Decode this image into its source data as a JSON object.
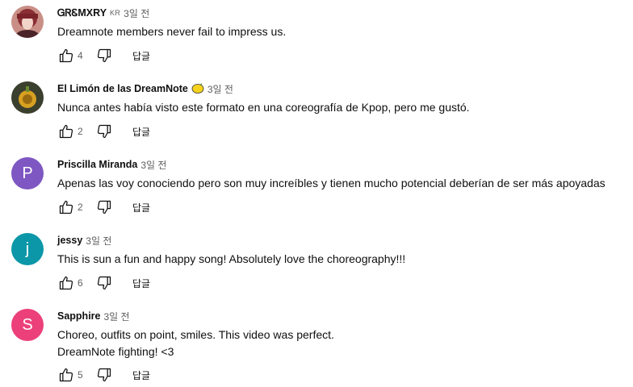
{
  "comments": [
    {
      "author": "ᏀᏒᏋMXRY",
      "flag": "KR",
      "time": "3일 전",
      "lines": [
        "Dreamnote members never fail to impress us."
      ],
      "likes": "4",
      "reply_label": "답글",
      "avatar": {
        "type": "photo",
        "icon": "profile-photo"
      }
    },
    {
      "author": "El Limón de las DreamNote",
      "badge_icon": "lemon-emoji",
      "time": "3일 전",
      "lines": [
        "Nunca antes había visto este formato en una coreografía de Kpop, pero me gustó."
      ],
      "likes": "2",
      "reply_label": "답글",
      "avatar": {
        "type": "photo",
        "icon": "profile-photo"
      }
    },
    {
      "author": "Priscilla Miranda",
      "time": "3일 전",
      "lines": [
        "Apenas las voy conociendo pero son muy increíbles y tienen mucho potencial deberían de ser más apoyadas"
      ],
      "likes": "2",
      "reply_label": "답글",
      "avatar": {
        "type": "letter",
        "letter": "P",
        "color": "#7e57c2"
      }
    },
    {
      "author": "jessy",
      "time": "3일 전",
      "lines": [
        "This is sun a fun and happy song! Absolutely love the choreography!!!"
      ],
      "likes": "6",
      "reply_label": "답글",
      "avatar": {
        "type": "letter",
        "letter": "j",
        "color": "#0b97a8"
      }
    },
    {
      "author": "Sapphire",
      "time": "3일 전",
      "lines": [
        "Choreo, outfits on point, smiles. This video was perfect.",
        "DreamNote fighting! <3"
      ],
      "likes": "5",
      "reply_label": "답글",
      "avatar": {
        "type": "letter",
        "letter": "S",
        "color": "#ec407a"
      }
    }
  ]
}
